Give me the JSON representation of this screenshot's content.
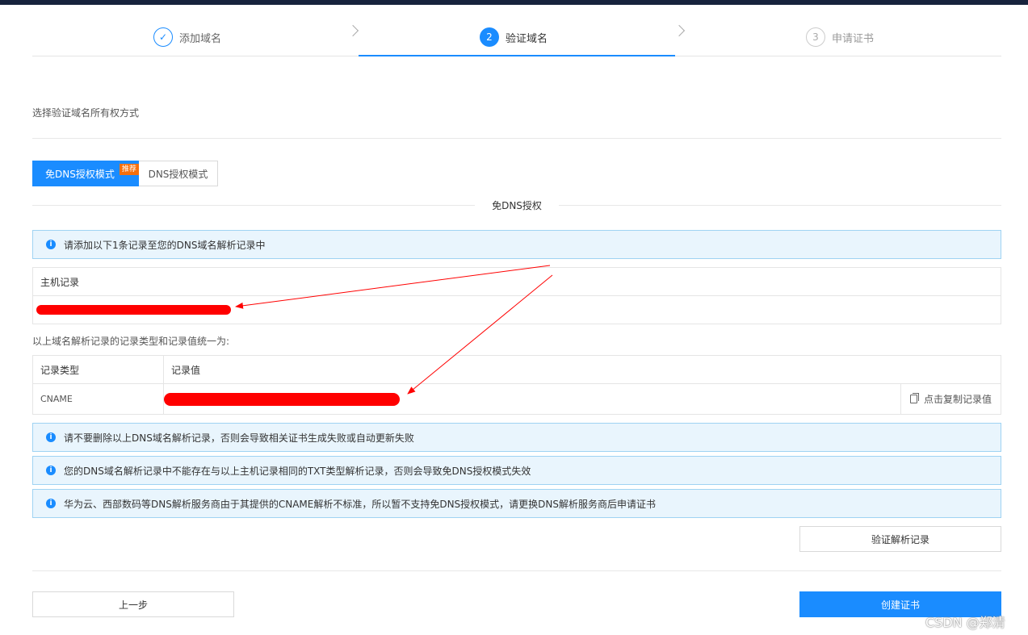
{
  "steps": [
    {
      "marker": "✓",
      "label": "添加域名"
    },
    {
      "marker": "2",
      "label": "验证域名"
    },
    {
      "marker": "3",
      "label": "申请证书"
    }
  ],
  "section_title": "选择验证域名所有权方式",
  "modes": {
    "active_label": "免DNS授权模式",
    "badge": "推荐",
    "other_label": "DNS授权模式"
  },
  "divider_title": "免DNS授权",
  "info_top": "请添加以下1条记录至您的DNS域名解析记录中",
  "host_table": {
    "header": "主机记录"
  },
  "record_note": "以上域名解析记录的记录类型和记录值统一为:",
  "record_table": {
    "col_type": "记录类型",
    "col_value": "记录值",
    "type_value": "CNAME",
    "copy_label": "点击复制记录值"
  },
  "tips": [
    "请不要删除以上DNS域名解析记录，否则会导致相关证书生成失败或自动更新失败",
    "您的DNS域名解析记录中不能存在与以上主机记录相同的TXT类型解析记录，否则会导致免DNS授权模式失效",
    "华为云、西部数码等DNS解析服务商由于其提供的CNAME解析不标准，所以暂不支持免DNS授权模式，请更换DNS解析服务商后申请证书"
  ],
  "buttons": {
    "verify": "验证解析记录",
    "prev": "上一步",
    "create": "创建证书"
  },
  "watermark": "CSDN @郑清",
  "colors": {
    "primary": "#1a8cff",
    "badge": "#f66f0c",
    "redact": "#ff0000"
  },
  "info_icon": "info-icon"
}
